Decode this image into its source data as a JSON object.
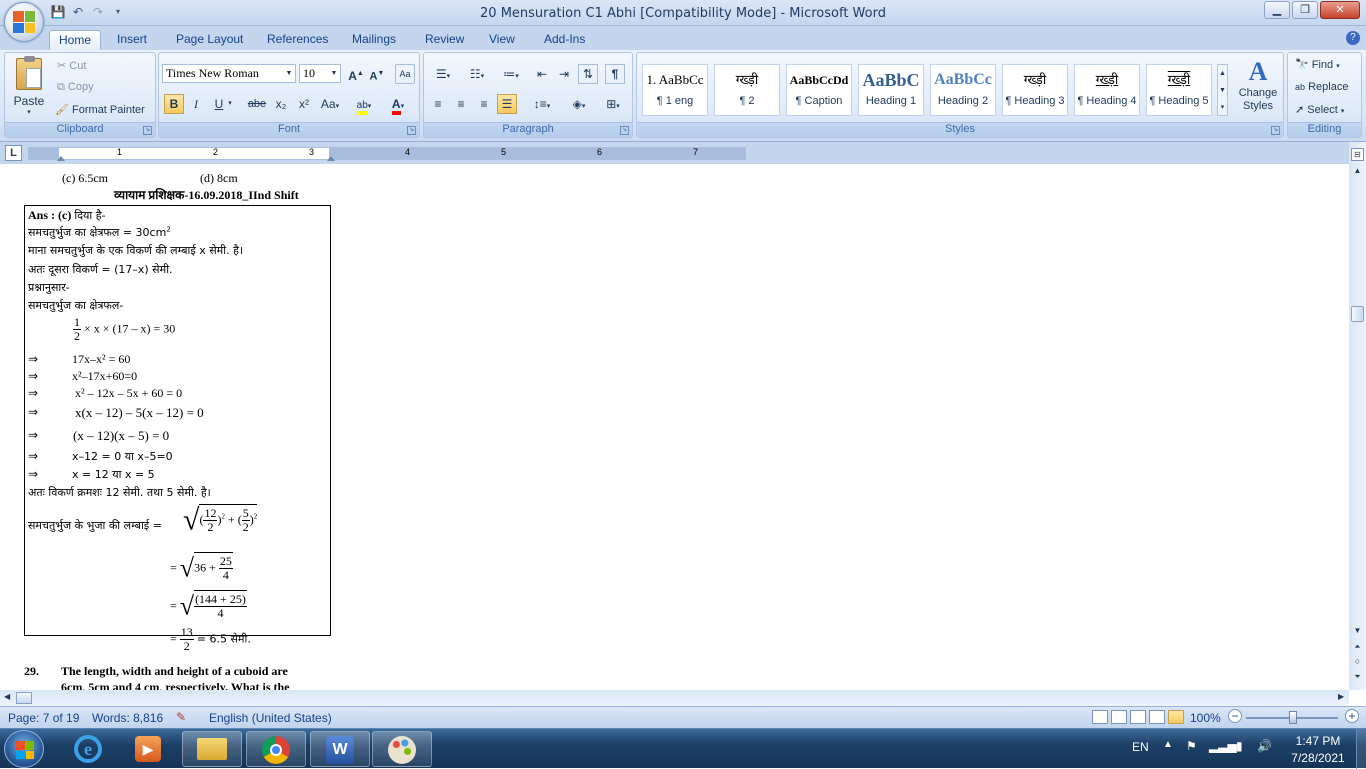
{
  "window": {
    "title": "20 Mensuration C1 Abhi [Compatibility Mode] - Microsoft Word",
    "minimize": "▁",
    "maximize": "❐",
    "close": "✕"
  },
  "ribbon_tabs": [
    "Home",
    "Insert",
    "Page Layout",
    "References",
    "Mailings",
    "Review",
    "View",
    "Add-Ins"
  ],
  "clipboard": {
    "paste": "Paste",
    "cut": "Cut",
    "copy": "Copy",
    "format_painter": "Format Painter",
    "label": "Clipboard"
  },
  "font": {
    "family": "Times New Roman",
    "size": "10",
    "label": "Font",
    "bold": "B",
    "italic": "I",
    "underline": "U",
    "strike": "abe",
    "subscript": "x₂",
    "superscript": "x²",
    "change_case": "Aa"
  },
  "paragraph": {
    "label": "Paragraph"
  },
  "styles": {
    "label": "Styles",
    "items": [
      {
        "sample": "1.  AaBbCc",
        "name": "¶ 1 eng"
      },
      {
        "sample": "ग्ख्ड़ी",
        "name": "¶ 2"
      },
      {
        "sample": "AaBbCcDd",
        "name": "¶ Caption"
      },
      {
        "sample": "AaBbC",
        "name": "Heading 1"
      },
      {
        "sample": "AaBbCc",
        "name": "Heading 2"
      },
      {
        "sample": "ग्ख्ड़ी",
        "name": "¶ Heading 3"
      },
      {
        "sample": "ग्ख्ड़ी",
        "name": "¶ Heading 4"
      },
      {
        "sample": "ग्ख्ड़ी",
        "name": "¶ Heading 5"
      }
    ],
    "change_styles": "Change Styles"
  },
  "editing": {
    "label": "Editing",
    "find": "Find",
    "replace": "Replace",
    "select": "Select"
  },
  "ruler_numbers": [
    "1",
    "2",
    "3",
    "4",
    "5",
    "6",
    "7"
  ],
  "document": {
    "options_line": {
      "c": "(c)   6.5cm",
      "d": "(d)    8cm"
    },
    "exam_heading": "व्यायाम प्रशिक्षक-16.09.2018_IInd Shift",
    "ans_label": "Ans : (c)",
    "lines": {
      "given": "दिया है-",
      "area_rhombus": "समचतुर्भुज का क्षेत्रफल = 30cm",
      "area_sup": "2",
      "assume": "माना समचतुर्भुज के एक विकर्ण की लम्बाई x सेमी. है।",
      "other_diag": "अतः दूसरा विकर्ण = (17–x) सेमी.",
      "according": "प्रश्नानुसार-",
      "area_label": "समचतुर्भुज का क्षेत्रफल-",
      "eq1_num": "1",
      "eq1_den": "2",
      "eq1_rest": "× x × (17 – x) = 30",
      "eq2": "17x–x² = 60",
      "eq3": "x²–17x+60=0",
      "eq4": "x² – 12x – 5x + 60 = 0",
      "eq5": "x(x – 12) – 5(x – 12) = 0",
      "eq6": "(x – 12)(x – 5) = 0",
      "eq7": "x–12 = 0 या x–5=0",
      "eq8": "x = 12 या x = 5",
      "diagonals": "अतः विकर्ण क्रमशः 12 सेमी. तथा 5 सेमी. है।",
      "side_label": "समचतुर्भुज के भुजा की लम्बाई",
      "r1_a_num": "12",
      "r1_a_den": "2",
      "r1_b_num": "5",
      "r1_b_den": "2",
      "r2_a": "36 +",
      "r2_num": "25",
      "r2_den": "4",
      "r3_num": "(144 + 25)",
      "r3_den": "4",
      "r4_num": "13",
      "r4_den": "2",
      "r4_rest": "= 6.5 सेमी."
    },
    "implies": "⇒",
    "q29_num": "29.",
    "q29_line1": "The length, width and height of a cuboid are",
    "q29_line2": "6cm, 5cm and 4 cm, respectively. What is the"
  },
  "status": {
    "page": "Page: 7 of 19",
    "words": "Words: 8,816",
    "language": "English (United States)",
    "zoom": "100%"
  },
  "taskbar": {
    "lang": "EN",
    "time": "1:47 PM",
    "date": "7/28/2021"
  },
  "colors": {
    "ribbon_bg": "#dbe7f6",
    "accent": "#15428b",
    "highlight": "#ffff00",
    "font_color": "#ff0000"
  }
}
